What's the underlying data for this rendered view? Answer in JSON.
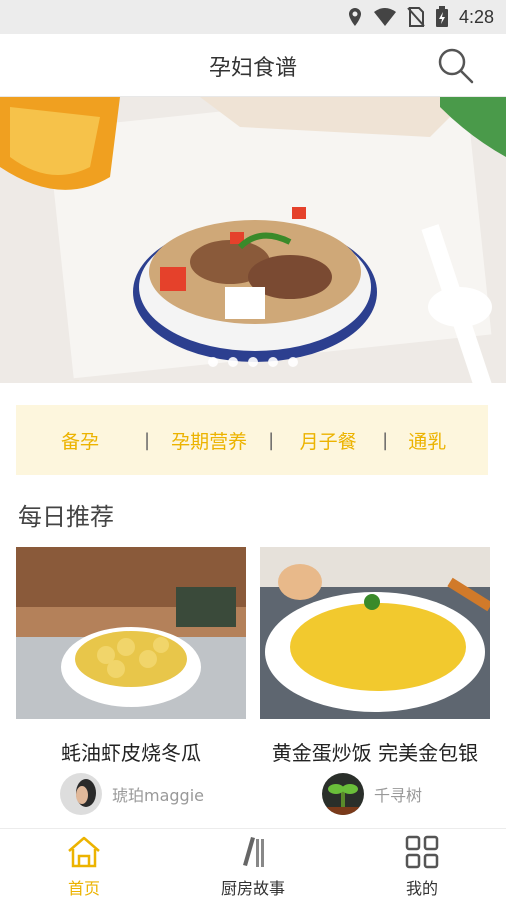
{
  "status": {
    "time": "4:28"
  },
  "header": {
    "title": "孕妇食谱"
  },
  "categories": [
    "备孕",
    "孕期营养",
    "月子餐",
    "通乳"
  ],
  "section": {
    "title": "每日推荐"
  },
  "recipes": [
    {
      "name": "蚝油虾皮烧冬瓜",
      "author": "琥珀maggie"
    },
    {
      "name": "黄金蛋炒饭 完美金包银",
      "author": "千寻树"
    }
  ],
  "tabs": [
    {
      "label": "首页",
      "icon": "home-icon",
      "active": true
    },
    {
      "label": "厨房故事",
      "icon": "books-icon",
      "active": false
    },
    {
      "label": "我的",
      "icon": "grid-icon",
      "active": false
    }
  ],
  "colors": {
    "accent": "#ecb300",
    "category_bg": "#fdf6dd"
  }
}
